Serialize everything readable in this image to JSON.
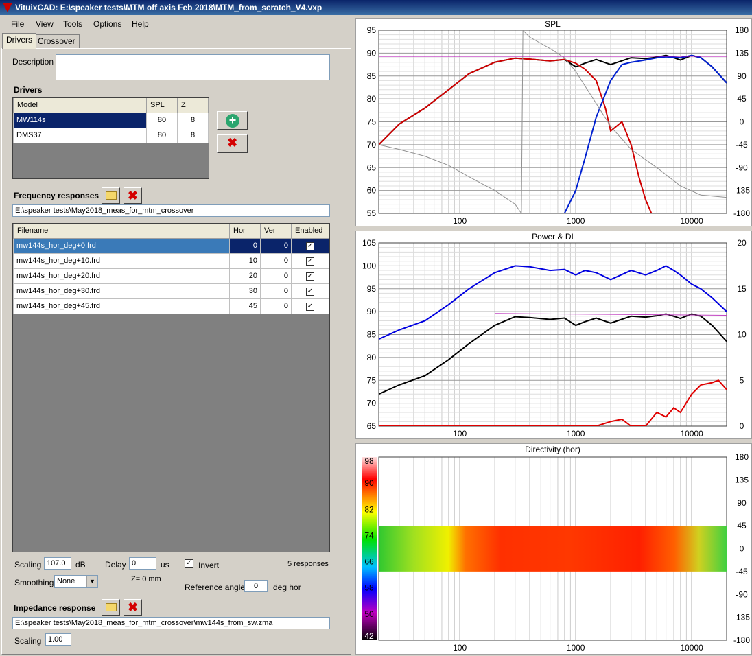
{
  "window": {
    "title": "VituixCAD: E:\\speaker tests\\MTM off axis Feb 2018\\MTM_from_scratch_V4.vxp"
  },
  "menu": [
    "File",
    "View",
    "Tools",
    "Options",
    "Help"
  ],
  "tabs": {
    "drivers": "Drivers",
    "crossover": "Crossover"
  },
  "description": {
    "label": "Description",
    "value": ""
  },
  "drivers": {
    "title": "Drivers",
    "columns": [
      "Model",
      "SPL",
      "Z"
    ],
    "rows": [
      {
        "model": "MW114s",
        "spl": "80",
        "z": "8"
      },
      {
        "model": "DMS37",
        "spl": "80",
        "z": "8"
      }
    ]
  },
  "freq": {
    "title": "Frequency responses",
    "path": "E:\\speaker tests\\May2018_meas_for_mtm_crossover",
    "columns": [
      "Filename",
      "Hor",
      "Ver",
      "Enabled"
    ],
    "rows": [
      {
        "file": "mw144s_hor_deg+0.frd",
        "hor": "0",
        "ver": "0",
        "enabled": true
      },
      {
        "file": "mw144s_hor_deg+10.frd",
        "hor": "10",
        "ver": "0",
        "enabled": true
      },
      {
        "file": "mw144s_hor_deg+20.frd",
        "hor": "20",
        "ver": "0",
        "enabled": true
      },
      {
        "file": "mw144s_hor_deg+30.frd",
        "hor": "30",
        "ver": "0",
        "enabled": true
      },
      {
        "file": "mw144s_hor_deg+45.frd",
        "hor": "45",
        "ver": "0",
        "enabled": true
      }
    ]
  },
  "controls": {
    "scaling_label": "Scaling",
    "scaling_value": "107.0",
    "scaling_unit": "dB",
    "delay_label": "Delay",
    "delay_value": "0",
    "delay_unit": "us",
    "invert_label": "Invert",
    "invert_checked": true,
    "responses": "5 responses",
    "smoothing_label": "Smoothing",
    "smoothing_value": "None",
    "z_text": "Z= 0 mm",
    "ref_angle_label": "Reference angle",
    "ref_angle_value": "0",
    "ref_angle_unit": "deg hor"
  },
  "impedance": {
    "title": "Impedance response",
    "path": "E:\\speaker tests\\May2018_meas_for_mtm_crossover\\mw144s_from_sw.zma",
    "scaling_label": "Scaling",
    "scaling_value": "1.00"
  },
  "chart_data": [
    {
      "type": "line",
      "title": "SPL",
      "x_scale": "log",
      "xlim": [
        20,
        20000
      ],
      "x_ticks": [
        "100",
        "1000",
        "10000"
      ],
      "ylim": [
        55,
        95
      ],
      "y_ticks": [
        "55",
        "60",
        "65",
        "70",
        "75",
        "80",
        "85",
        "90",
        "95"
      ],
      "y2lim": [
        -180,
        180
      ],
      "y2_ticks": [
        "-180",
        "-135",
        "-90",
        "-45",
        "0",
        "45",
        "90",
        "135",
        "180"
      ],
      "grid": true,
      "series": [
        {
          "color": "#000000",
          "x": [
            20,
            30,
            50,
            80,
            120,
            200,
            300,
            400,
            600,
            800,
            1000,
            1200,
            1500,
            2000,
            3000,
            4000,
            5000,
            6000,
            7000,
            8000,
            10000,
            12000,
            15000,
            20000
          ],
          "y": [
            70,
            74.5,
            78,
            82,
            85.5,
            88,
            88.9,
            88.7,
            88.3,
            88.6,
            87,
            87.8,
            88.6,
            87.5,
            89,
            88.8,
            89.1,
            89.5,
            89,
            88.5,
            89.5,
            89,
            87,
            83.5
          ]
        },
        {
          "color": "#d00000",
          "x": [
            20,
            30,
            50,
            80,
            120,
            200,
            300,
            400,
            600,
            800,
            1000,
            1200,
            1500,
            1800,
            2000,
            2500,
            3000,
            3500,
            4000,
            4500
          ],
          "y": [
            70,
            74.5,
            78,
            82,
            85.5,
            88,
            88.9,
            88.7,
            88.3,
            88.6,
            87.8,
            86.5,
            84,
            78,
            73,
            75,
            70,
            63,
            58,
            55
          ]
        },
        {
          "color": "#0020d0",
          "x": [
            800,
            1000,
            1200,
            1500,
            2000,
            2500,
            3000,
            4000,
            5000,
            6000,
            8000,
            10000,
            12000,
            15000,
            20000
          ],
          "y": [
            55,
            60,
            67,
            76,
            84,
            87.5,
            88,
            88.5,
            89,
            89.2,
            89,
            89.5,
            89,
            87,
            83.5
          ]
        },
        {
          "color": "#909090",
          "x": [
            20,
            30,
            50,
            80,
            120,
            200,
            300,
            340,
            350,
            400,
            600,
            800,
            1000,
            1500,
            2000,
            3000,
            5000,
            8000,
            12000,
            20000
          ],
          "y": [
            70,
            69,
            67.5,
            65.5,
            63,
            60,
            57,
            55,
            95,
            93.5,
            91,
            89,
            86,
            79,
            74,
            69,
            65,
            61,
            59,
            58.5
          ]
        },
        {
          "color": "#b000b0",
          "x": [
            20,
            20000
          ],
          "y": [
            89.3,
            89.3
          ]
        }
      ]
    },
    {
      "type": "line",
      "title": "Power & DI",
      "x_scale": "log",
      "xlim": [
        20,
        20000
      ],
      "x_ticks": [
        "100",
        "1000",
        "10000"
      ],
      "ylim": [
        65,
        105
      ],
      "y_ticks": [
        "65",
        "70",
        "75",
        "80",
        "85",
        "90",
        "95",
        "100",
        "105"
      ],
      "y2lim": [
        0,
        20
      ],
      "y2_ticks": [
        "0",
        "5",
        "10",
        "15",
        "20"
      ],
      "grid": true,
      "series": [
        {
          "color": "#0000e0",
          "x": [
            20,
            30,
            50,
            80,
            120,
            200,
            300,
            400,
            600,
            800,
            1000,
            1200,
            1500,
            2000,
            3000,
            4000,
            5000,
            6000,
            7000,
            8000,
            10000,
            12000,
            15000,
            20000
          ],
          "y": [
            84,
            86,
            88,
            91.5,
            95,
            98.5,
            100,
            99.8,
            99,
            99.2,
            98,
            99,
            98.5,
            97,
            99,
            98,
            99,
            100,
            99,
            98,
            96,
            95,
            93,
            90
          ]
        },
        {
          "color": "#000000",
          "x": [
            20,
            30,
            50,
            80,
            120,
            200,
            300,
            400,
            600,
            800,
            1000,
            1200,
            1500,
            2000,
            3000,
            4000,
            5000,
            6000,
            7000,
            8000,
            10000,
            12000,
            15000,
            20000
          ],
          "y": [
            72,
            74,
            76,
            79.5,
            83,
            87,
            88.9,
            88.7,
            88.3,
            88.6,
            87,
            87.8,
            88.6,
            87.5,
            89,
            88.8,
            89.1,
            89.5,
            89,
            88.5,
            89.5,
            89,
            87,
            83.5
          ]
        },
        {
          "color": "#e00000",
          "x": [
            20,
            1500,
            2000,
            2500,
            3000,
            4000,
            5000,
            6000,
            7000,
            8000,
            10000,
            12000,
            15000,
            17000,
            20000
          ],
          "y": [
            65,
            65,
            66,
            66.5,
            65,
            65,
            68,
            67,
            69,
            68,
            72,
            74,
            74.5,
            75,
            73
          ]
        },
        {
          "color": "#c040c0",
          "x": [
            200,
            20000
          ],
          "y": [
            89.6,
            89.2
          ]
        }
      ]
    },
    {
      "type": "heatmap",
      "title": "Directivity (hor)",
      "x_scale": "log",
      "xlim": [
        20,
        20000
      ],
      "x_ticks": [
        "100",
        "1000",
        "10000"
      ],
      "y2lim": [
        -180,
        180
      ],
      "y2_ticks": [
        "-180",
        "-135",
        "-90",
        "-45",
        "0",
        "45",
        "90",
        "135",
        "180"
      ],
      "colorbar_ticks": [
        "42",
        "50",
        "58",
        "66",
        "74",
        "82",
        "90",
        "98"
      ],
      "band_angle": [
        -45,
        45
      ]
    }
  ]
}
